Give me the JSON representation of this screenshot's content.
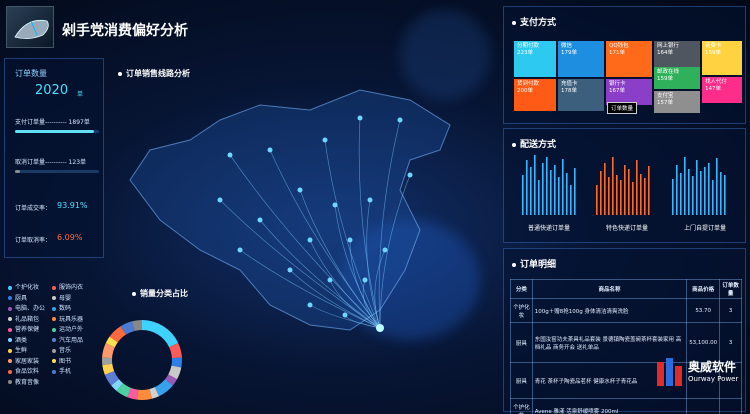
{
  "header": {
    "title": "剁手党消费偏好分析"
  },
  "orders": {
    "title": "订单数量",
    "count": "2020",
    "unit": "单",
    "paid_label": "支付订单量---------- 1897单",
    "paid_fraction": 0.94,
    "cancel_label": "取消订单量---------- 123单",
    "cancel_fraction": 0.06,
    "success_rate_label": "订单成交率：",
    "success_rate": "93.91%",
    "cancel_rate_label": "订单取消率：",
    "cancel_rate": "6.09%",
    "colors": {
      "paid": "#5fe0f5",
      "cancel": "#8b8b8b",
      "success": "#4be3ff",
      "cancel_rate": "#ff6a3d"
    }
  },
  "map": {
    "title": "订单销售线路分析"
  },
  "category": {
    "title": "销量分类占比",
    "items": [
      {
        "label": "个护化妆",
        "color": "#3fd2ff"
      },
      {
        "label": "服饰内衣",
        "color": "#ff5a5a"
      },
      {
        "label": "厨具",
        "color": "#2f7fe8"
      },
      {
        "label": "母婴",
        "color": "#c9c9c9"
      },
      {
        "label": "电脑、办公",
        "color": "#9b59b6"
      },
      {
        "label": "数码",
        "color": "#36a2eb"
      },
      {
        "label": "礼品箱包",
        "color": "#d0d0d0"
      },
      {
        "label": "玩具乐器",
        "color": "#ff8c3a"
      },
      {
        "label": "营养保健",
        "color": "#ff5ba1"
      },
      {
        "label": "运动户外",
        "color": "#4dd0a0"
      },
      {
        "label": "酒类",
        "color": "#7fd6ff"
      },
      {
        "label": "汽车用品",
        "color": "#5c7fd6"
      },
      {
        "label": "生鲜",
        "color": "#ffd34d"
      },
      {
        "label": "音乐",
        "color": "#a0a0a0"
      },
      {
        "label": "家居家装",
        "color": "#ff9a6a"
      },
      {
        "label": "图书",
        "color": "#ffe14d"
      },
      {
        "label": "食品饮料",
        "color": "#ff6a3d"
      },
      {
        "label": "手机",
        "color": "#4b7bd6"
      },
      {
        "label": "教育音像",
        "color": "#888888"
      }
    ]
  },
  "payment": {
    "title": "支付方式",
    "tiles": [
      {
        "name": "分期付款",
        "count": "223单",
        "color": "#2ec9ef"
      },
      {
        "name": "微信",
        "count": "179单",
        "color": "#1e8fe0"
      },
      {
        "name": "QQ钱包",
        "count": "171单",
        "color": "#ff6a1a"
      },
      {
        "name": "网上银行",
        "count": "164单",
        "color": "#4f565f"
      },
      {
        "name": "话费卡",
        "count": "159单",
        "color": "#ffd23f"
      },
      {
        "name": "货到付款",
        "count": "200单",
        "color": "#ff5a16"
      },
      {
        "name": "充值卡",
        "count": "178单",
        "color": "#3b5f7d"
      },
      {
        "name": "银行卡",
        "count": "167单",
        "color": "#8b3fc9"
      },
      {
        "name": "邮政在线",
        "count": "159单",
        "color": "#2fb05a"
      },
      {
        "name": "找人代付",
        "count": "147单",
        "color": "#ff2d8a"
      },
      {
        "name": "支付宝",
        "count": "157单",
        "color": "#8f8f8f"
      }
    ],
    "tooltip": "订单数量"
  },
  "shipping": {
    "title": "配送方式",
    "labels": [
      "普通快递订单量",
      "特色快递订单量",
      "上门自提订单量"
    ],
    "colors": [
      "#35b8ff",
      "#ff6a2a",
      "#35b8ff"
    ]
  },
  "detail": {
    "title": "订单明细",
    "headers": [
      "分类",
      "商品名称",
      "商品价格",
      "订单数量"
    ],
    "rows": [
      {
        "cat": "个护化妆",
        "name": "100g＋赠8抢100g 身体清洁清爽洗脸",
        "price": "53.70",
        "qty": "3"
      },
      {
        "cat": "厨具",
        "name": "东国汝窑功夫茶具礼品套装 景德镇陶瓷盖碗茶杯套装家用 高档礼品 商务开会 送礼单品",
        "price": "53,100.00",
        "qty": "3"
      },
      {
        "cat": "厨具",
        "name": "青花 茶杯子陶瓷品茗杯 健康水杯子青花品",
        "price": "",
        "qty": ""
      },
      {
        "cat": "个护化妆",
        "name": "Avene 雅漾 活泉舒缓喷雾 200ml",
        "price": "",
        "qty": ""
      }
    ]
  },
  "watermark": {
    "name": "奥威软件",
    "sub": "Ourway Power"
  }
}
